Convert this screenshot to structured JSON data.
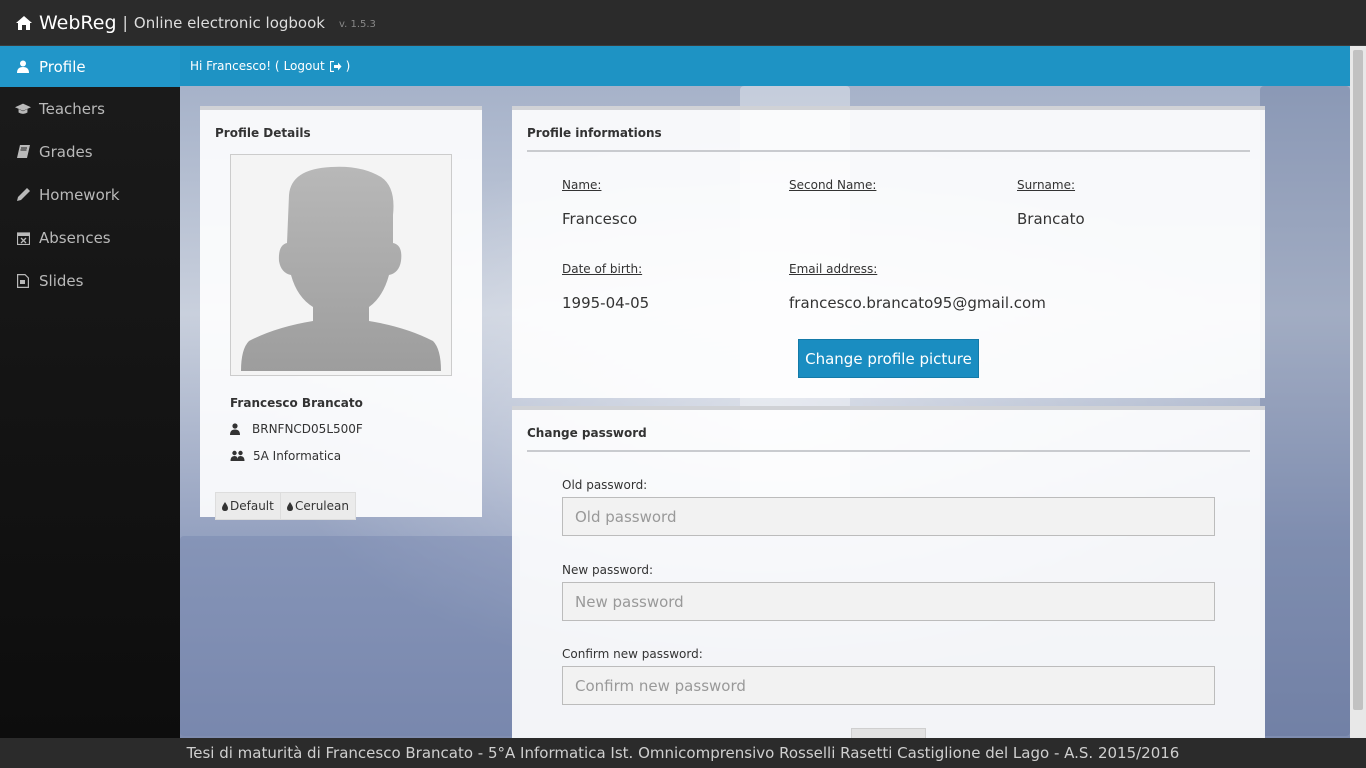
{
  "app": {
    "brand": "WebReg",
    "separator": "|",
    "subtitle": "Online electronic logbook",
    "version": "v. 1.5.3"
  },
  "sidebar": {
    "items": [
      {
        "label": "Profile",
        "icon": "user-icon",
        "active": true
      },
      {
        "label": "Teachers",
        "icon": "graduation-cap-icon",
        "active": false
      },
      {
        "label": "Grades",
        "icon": "book-icon",
        "active": false
      },
      {
        "label": "Homework",
        "icon": "pencil-icon",
        "active": false
      },
      {
        "label": "Absences",
        "icon": "calendar-times-icon",
        "active": false
      },
      {
        "label": "Slides",
        "icon": "file-slides-icon",
        "active": false
      }
    ]
  },
  "userbar": {
    "greeting": "Hi Francesco! (",
    "logout": "Logout",
    "closing": ")"
  },
  "profile_panel": {
    "title": "Profile Details",
    "full_name": "Francesco Brancato",
    "fiscal_code": "BRNFNCD05L500F",
    "class": "5A Informatica",
    "themes": [
      "Default",
      "Cerulean"
    ]
  },
  "info_panel": {
    "title": "Profile informations",
    "name_label": "Name:",
    "name_value": "Francesco",
    "second_name_label": "Second Name:",
    "second_name_value": "",
    "surname_label": "Surname:",
    "surname_value": "Brancato",
    "dob_label": "Date of birth:",
    "dob_value": "1995-04-05",
    "email_label": "Email address:",
    "email_value": "francesco.brancato95@gmail.com",
    "change_picture_button": "Change profile picture"
  },
  "password_panel": {
    "title": "Change password",
    "old_label": "Old password:",
    "old_placeholder": "Old password",
    "new_label": "New password:",
    "new_placeholder": "New password",
    "confirm_label": "Confirm new password:",
    "confirm_placeholder": "Confirm new password"
  },
  "footer": {
    "text": "Tesi di maturità di Francesco Brancato - 5°A Informatica Ist. Omnicomprensivo Rosselli Rasetti Castiglione del Lago - A.S. 2015/2016"
  },
  "colors": {
    "accent": "#1e93c4",
    "button": "#1a8dc1",
    "navbar": "#2b2b2b",
    "sidebar": "#141414"
  }
}
